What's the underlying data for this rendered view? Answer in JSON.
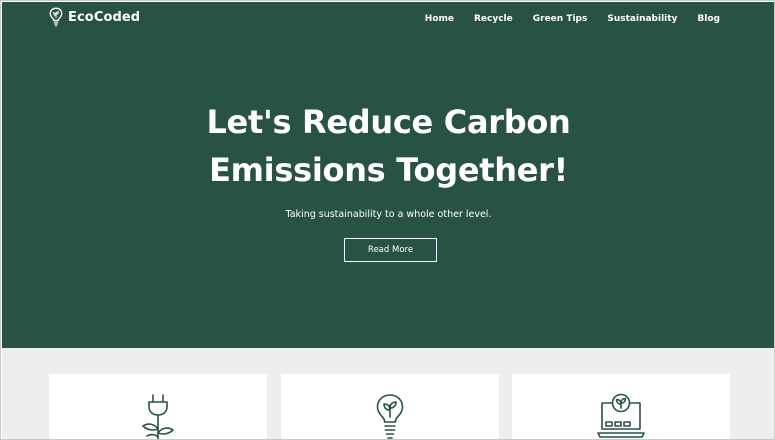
{
  "brand": {
    "name": "EcoCoded",
    "logo_icon": "lightbulb-leaf-icon"
  },
  "nav": {
    "items": [
      "Home",
      "Recycle",
      "Green Tips",
      "Sustainability",
      "Blog"
    ]
  },
  "hero": {
    "headline_line1": "Let's Reduce Carbon",
    "headline_line2": "Emissions Together!",
    "subtitle": "Taking sustainability to a whole other level.",
    "cta_label": "Read More"
  },
  "features": {
    "cards": [
      {
        "icon": "plug-plant-icon"
      },
      {
        "icon": "lightbulb-leaf-icon"
      },
      {
        "icon": "laptop-eco-icon"
      }
    ]
  },
  "colors": {
    "hero_background": "#285246",
    "icon_green": "#285246",
    "section_background": "#eeeeee"
  }
}
